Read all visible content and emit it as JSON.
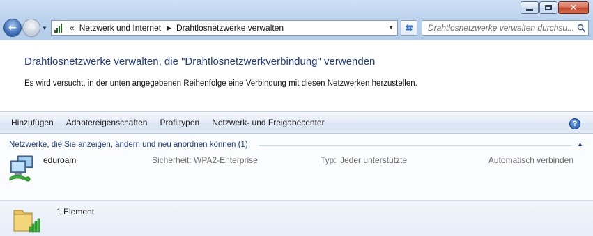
{
  "window": {
    "minimize_label": "",
    "maximize_label": "",
    "close_label": "✕"
  },
  "nav": {
    "back_glyph": "←",
    "forward_glyph": "→"
  },
  "address": {
    "overflow_chevron": "«",
    "breadcrumbs": [
      "Netzwerk und Internet",
      "Drahtlosnetzwerke verwalten"
    ],
    "separator": "▶"
  },
  "search": {
    "placeholder": "Drahtlosnetzwerke verwalten durchsu..."
  },
  "header": {
    "title": "Drahtlosnetzwerke verwalten, die \"Drahtlosnetzwerkverbindung\" verwenden",
    "description": "Es wird versucht, in der unten angegebenen Reihenfolge eine Verbindung mit diesen Netzwerken herzustellen."
  },
  "toolbar": {
    "items": [
      "Hinzufügen",
      "Adaptereigenschaften",
      "Profiltypen",
      "Netzwerk- und Freigabecenter"
    ],
    "help_label": "?"
  },
  "list": {
    "group_header": "Netzwerke, die Sie anzeigen, ändern und neu anordnen können (1)",
    "group_toggle": "▲",
    "networks": [
      {
        "name": "eduroam",
        "security_label": "Sicherheit:",
        "security_value": "WPA2-Enterprise",
        "type_label": "Typ:",
        "type_value": "Jeder unterstützte",
        "connect_mode": "Automatisch verbinden"
      }
    ]
  },
  "details": {
    "item_count": "1 Element"
  },
  "icons": {
    "address_icon": "signal-bars-icon",
    "network_icon": "wireless-network-icon",
    "details_icon": "folder-signal-icon",
    "search_icon": "magnifier-icon",
    "refresh_icon": "refresh-icon"
  },
  "colors": {
    "title_blue": "#1e3a8a",
    "link_blue": "#1e3c8a",
    "signal_green": "#2d9b2d"
  }
}
